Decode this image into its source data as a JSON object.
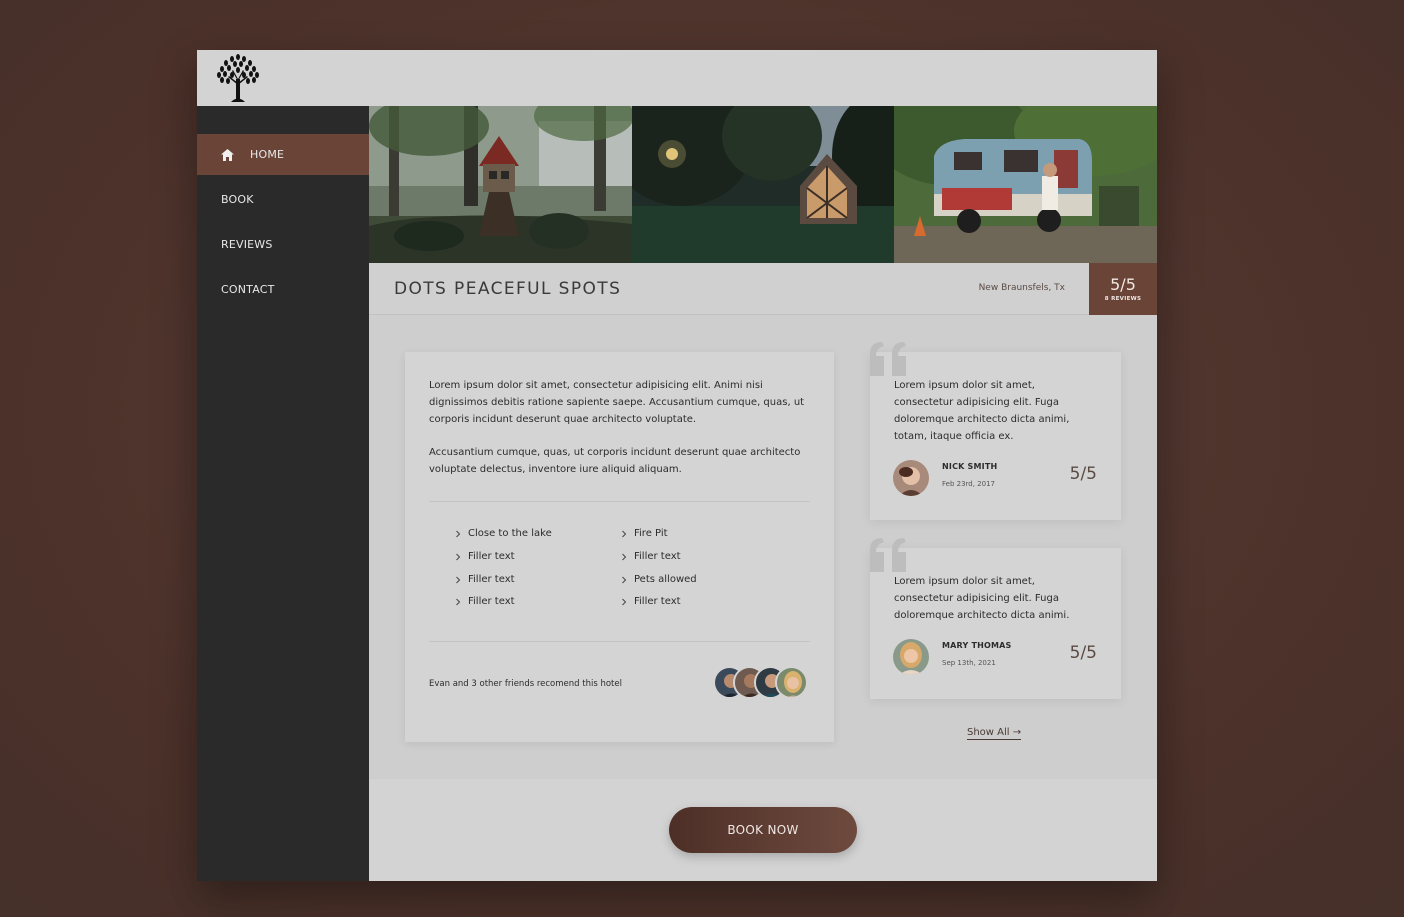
{
  "nav": {
    "items": [
      {
        "label": "HOME",
        "icon": "home-icon",
        "active": true
      },
      {
        "label": "BOOK",
        "active": false
      },
      {
        "label": "REVIEWS",
        "active": false
      },
      {
        "label": "CONTACT",
        "active": false
      }
    ]
  },
  "listing": {
    "title": "DOTS PEACEFUL SPOTS",
    "location": "New Braunsfels, Tx",
    "score": "5/5",
    "review_count": "8 REVIEWS",
    "paragraph1": "Lorem ipsum dolor sit amet, consectetur adipisicing elit. Animi nisi dignissimos debitis ratione sapiente saepe. Accusantium cumque, quas, ut corporis incidunt deserunt quae architecto voluptate.",
    "paragraph2": "Accusantium cumque, quas, ut corporis incidunt deserunt quae architecto voluptate delectus, inventore iure aliquid aliquam.",
    "features_left": [
      "Close to the lake",
      "Filler text",
      "Filler text",
      "Filler text"
    ],
    "features_right": [
      "Fire Pit",
      "Filler text",
      "Pets allowed",
      "Filler text"
    ],
    "friends_text": "Evan and 3 other friends recomend this hotel"
  },
  "reviews": [
    {
      "text": "Lorem ipsum dolor sit amet, consectetur adipisicing elit. Fuga doloremque architecto dicta animi, totam, itaque officia ex.",
      "name": "NICK SMITH",
      "date": "Feb 23rd, 2017",
      "score": "5/5"
    },
    {
      "text": "Lorem ipsum dolor sit amet, consectetur adipisicing elit. Fuga doloremque architecto dicta animi.",
      "name": "MARY THOMAS",
      "date": "Sep 13th, 2021",
      "score": "5/5"
    }
  ],
  "show_all_label": "Show All →",
  "book_button": "BOOK NOW",
  "colors": {
    "accent": "#6a4437",
    "sidebar": "#2a2a2a",
    "page_bg": "#4f352d"
  }
}
